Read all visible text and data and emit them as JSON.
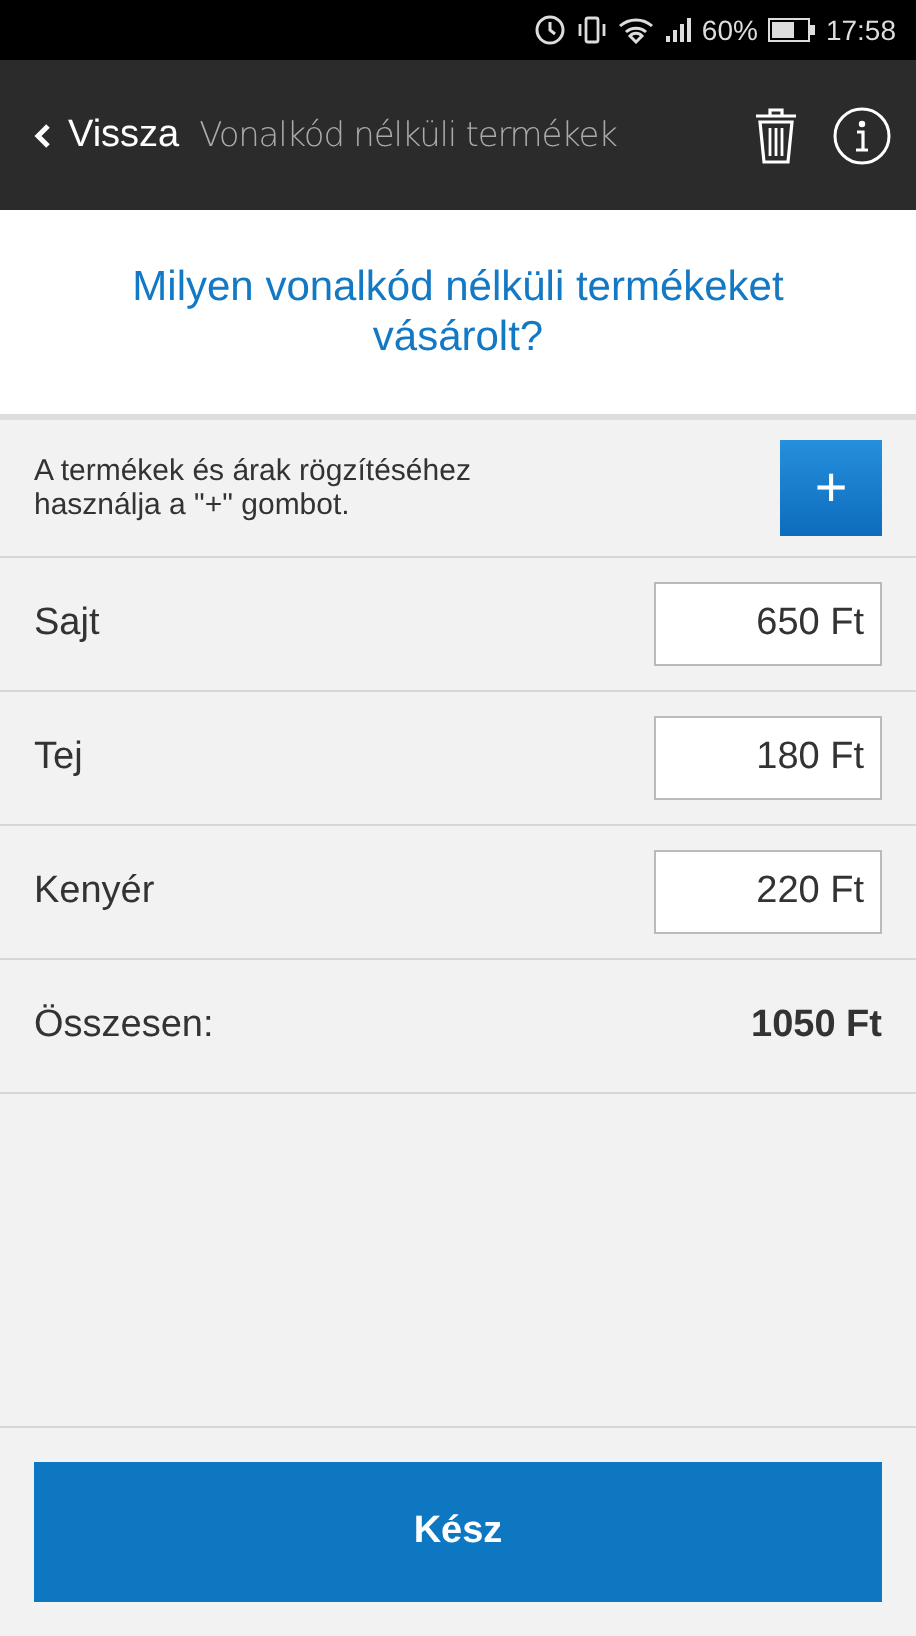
{
  "status_bar": {
    "battery_percent": "60%",
    "time": "17:58"
  },
  "header": {
    "back_label": "Vissza",
    "title": "Vonalkód nélküli termékek"
  },
  "question": "Milyen vonalkód nélküli termékeket vásárolt?",
  "hint": {
    "text": "A termékek és árak rögzítéséhez használja a \"+\" gombot.",
    "add_button": "+"
  },
  "items": [
    {
      "name": "Sajt",
      "price": "650 Ft"
    },
    {
      "name": "Tej",
      "price": "180 Ft"
    },
    {
      "name": "Kenyér",
      "price": "220 Ft"
    }
  ],
  "total": {
    "label": "Összesen:",
    "value": "1050 Ft"
  },
  "done_button": "Kész"
}
